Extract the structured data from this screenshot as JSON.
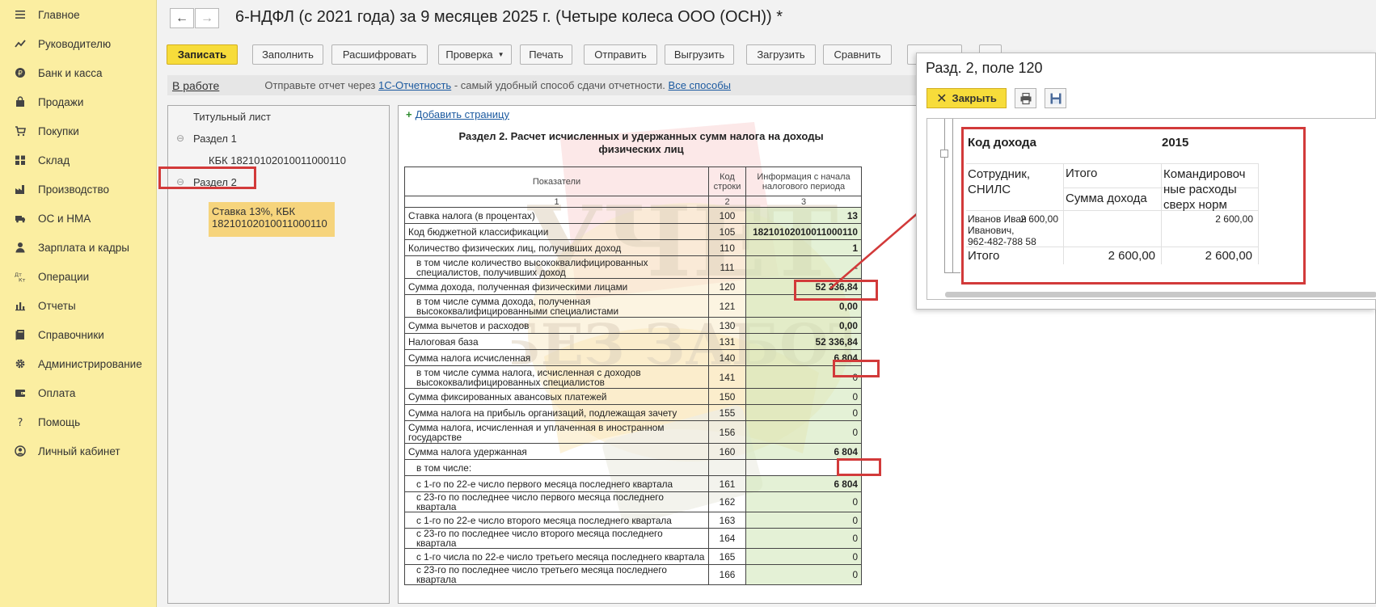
{
  "sidebar": {
    "items": [
      {
        "label": "Главное",
        "icon": "menu-icon"
      },
      {
        "label": "Руководителю",
        "icon": "trend-icon"
      },
      {
        "label": "Банк и касса",
        "icon": "ruble-icon"
      },
      {
        "label": "Продажи",
        "icon": "bag-icon"
      },
      {
        "label": "Покупки",
        "icon": "cart-icon"
      },
      {
        "label": "Склад",
        "icon": "warehouse-icon"
      },
      {
        "label": "Производство",
        "icon": "factory-icon"
      },
      {
        "label": "ОС и НМА",
        "icon": "truck-icon"
      },
      {
        "label": "Зарплата и кадры",
        "icon": "person-icon"
      },
      {
        "label": "Операции",
        "icon": "operations-icon"
      },
      {
        "label": "Отчеты",
        "icon": "bar-chart-icon"
      },
      {
        "label": "Справочники",
        "icon": "book-icon"
      },
      {
        "label": "Администрирование",
        "icon": "gear-icon"
      },
      {
        "label": "Оплата",
        "icon": "wallet-icon"
      },
      {
        "label": "Помощь",
        "icon": "question-icon"
      },
      {
        "label": "Личный кабинет",
        "icon": "account-icon"
      }
    ]
  },
  "header": {
    "back": "←",
    "forward": "→",
    "title": "6-НДФЛ (с 2021 года) за 9 месяцев 2025 г. (Четыре колеса ООО (ОСН)) *"
  },
  "toolbar": {
    "save": "Записать",
    "fill": "Заполнить",
    "decode": "Расшифровать",
    "check": "Проверка",
    "print": "Печать",
    "send": "Отправить",
    "export": "Выгрузить",
    "import": "Загрузить",
    "compare": "Сравнить"
  },
  "infobar": {
    "status": "В работе",
    "msg_prefix": "Отправьте отчет через ",
    "msg_link": "1С-Отчетность",
    "msg_suffix": " - самый удобный способ сдачи отчетности. ",
    "all_methods": "Все способы"
  },
  "tree": {
    "title_page": "Титульный лист",
    "section1": "Раздел 1",
    "kbk": "КБК 18210102010011000110",
    "section2": "Раздел 2",
    "selected_line1": "Ставка 13%, КБК",
    "selected_line2": "18210102010011000110",
    "collapse": "⊖"
  },
  "report": {
    "add_page": "Добавить страницу",
    "title_line1": "Раздел 2. Расчет исчисленных и удержанных сумм налога на доходы",
    "title_line2": "физических лиц",
    "head_col1": "Показатели",
    "head_col2": "Код строки",
    "head_col3": "Информация с начала налогового периода",
    "num1": "1",
    "num2": "2",
    "num3": "3",
    "rows": [
      {
        "label": "Ставка налога (в процентах)",
        "code": "100",
        "value": "13"
      },
      {
        "label": "Код бюджетной классификации",
        "code": "105",
        "value": "18210102010011000110"
      },
      {
        "label": "Количество физических лиц, получивших доход",
        "code": "110",
        "value": "1"
      },
      {
        "label": "в том числе количество высококвалифицированных специалистов, получивших доход",
        "code": "111",
        "value": "-"
      },
      {
        "label": "Сумма дохода, полученная физическими лицами",
        "code": "120",
        "value": "52 336,84"
      },
      {
        "label": "в том числе сумма дохода, полученная высококвалифицированными специалистами",
        "code": "121",
        "value": "0,00"
      },
      {
        "label": "Сумма вычетов и расходов",
        "code": "130",
        "value": "0,00"
      },
      {
        "label": "Налоговая база",
        "code": "131",
        "value": "52 336,84"
      },
      {
        "label": "Сумма налога исчисленная",
        "code": "140",
        "value": "6 804"
      },
      {
        "label": "в том числе сумма налога, исчисленная с доходов высококвалифицированных специалистов",
        "code": "141",
        "value": "0"
      },
      {
        "label": "Сумма фиксированных авансовых платежей",
        "code": "150",
        "value": "0"
      },
      {
        "label": "Сумма налога на прибыль организаций, подлежащая зачету",
        "code": "155",
        "value": "0"
      },
      {
        "label": "Сумма налога, исчисленная и уплаченная в иностранном государстве",
        "code": "156",
        "value": "0"
      },
      {
        "label": "Сумма налога удержанная",
        "code": "160",
        "value": "6 804"
      },
      {
        "label": "в том числе:",
        "code": "",
        "value": ""
      },
      {
        "label": "с 1-го по 22-е число первого месяца последнего квартала",
        "code": "161",
        "value": "6 804"
      },
      {
        "label": "с 23-го по последнее число первого месяца последнего квартала",
        "code": "162",
        "value": "0"
      },
      {
        "label": "с 1-го по 22-е число второго месяца последнего квартала",
        "code": "163",
        "value": "0"
      },
      {
        "label": "с 23-го по последнее число второго месяца последнего квартала",
        "code": "164",
        "value": "0"
      },
      {
        "label": "с 1-го числа по 22-е число третьего месяца последнего квартала",
        "code": "165",
        "value": "0"
      },
      {
        "label": "с 23-го по последнее число третьего месяца последнего квартала",
        "code": "166",
        "value": "0"
      }
    ]
  },
  "popup": {
    "title": "Разд. 2, поле 120",
    "close": "Закрыть",
    "income_code_label": "Код дохода",
    "income_code": "2015",
    "employee_header_l1": "Сотрудник,",
    "employee_header_l2": "СНИЛС",
    "total_header": "Итого",
    "sum_header": "Сумма дохода",
    "travel_header_l1": "Командировоч",
    "travel_header_l2": "ные расходы",
    "travel_header_l3": "сверх норм",
    "employee_l1": "Иванов Иван",
    "employee_l2": "Иванович,",
    "employee_l3": "962-482-788 58",
    "employee_total": "2 600,00",
    "employee_travel": "2 600,00",
    "footer_label": "Итого",
    "footer_total": "2 600,00",
    "footer_travel": "2 600,00"
  },
  "colors": {
    "sidebar_bg": "#fbeea1",
    "accent_yellow": "#f7dc3a",
    "highlight_red": "#d23a3a",
    "link_blue": "#1c5aa0",
    "selected_tree": "#f6d47c"
  }
}
